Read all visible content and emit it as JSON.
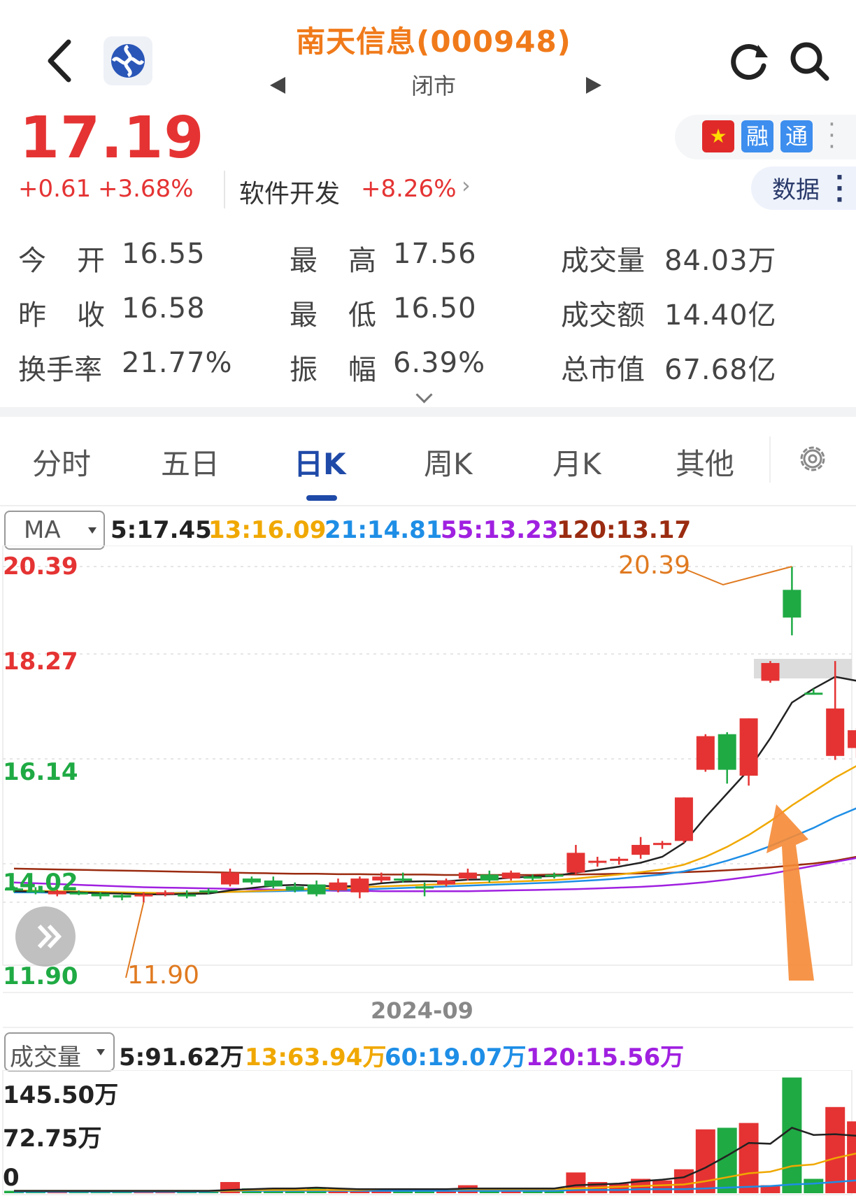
{
  "header": {
    "title": "南天信息(000948)",
    "status": "闭市",
    "back_icon": "chevron-left-icon",
    "refresh_icon": "refresh-icon",
    "search_icon": "search-icon"
  },
  "quote": {
    "price": "17.19",
    "change": "+0.61",
    "change_pct": "+3.68%",
    "industry": "软件开发",
    "industry_pct": "+8.26%",
    "up_color": "#e53333",
    "down_color": "#1faa44"
  },
  "badges": {
    "cn": "★",
    "rong": "融",
    "tong": "通",
    "data_label": "数据"
  },
  "stats": {
    "open_label_a": "今",
    "open_label_b": "开",
    "open": "16.55",
    "high_label_a": "最",
    "high_label_b": "高",
    "high": "17.56",
    "volume_label": "成交量",
    "volume": "84.03万",
    "prev_label_a": "昨",
    "prev_label_b": "收",
    "prev": "16.58",
    "low_label_a": "最",
    "low_label_b": "低",
    "low": "16.50",
    "amount_label": "成交额",
    "amount": "14.40亿",
    "turnover_label": "换手率",
    "turnover": "21.77%",
    "amp_label_a": "振",
    "amp_label_b": "幅",
    "amplitude": "6.39%",
    "mcap_label": "总市值",
    "mcap": "67.68亿"
  },
  "tabs": [
    {
      "label": "分时"
    },
    {
      "label": "五日"
    },
    {
      "label": "日K"
    },
    {
      "label": "周K"
    },
    {
      "label": "月K"
    },
    {
      "label": "其他"
    }
  ],
  "ma_row": {
    "selector": "MA",
    "ma5": "5:17.45",
    "ma13": "13:16.09",
    "ma21": "21:14.81",
    "ma55": "55:13.23",
    "ma120": "120:13.17",
    "colors": {
      "ma5": "#222222",
      "ma13": "#f0a800",
      "ma21": "#1e8ee6",
      "ma55": "#a020e0",
      "ma120": "#9a2b10"
    }
  },
  "vol_row": {
    "selector": "成交量",
    "v5": "5:91.62万",
    "v13": "13:63.94万",
    "v60": "60:19.07万",
    "v120": "120:15.56万"
  },
  "y_labels": {
    "top": "20.39",
    "mid1": "18.27",
    "mid2": "16.14",
    "mid3": "14.02",
    "bottom": "11.90"
  },
  "vol_labels": {
    "top": "145.50万",
    "mid": "72.75万",
    "zero": "0"
  },
  "x_label": "2024-09",
  "chart_data": {
    "type": "candlestick",
    "ylim": [
      11.9,
      20.39
    ],
    "max_label": "20.39",
    "min_label": "11.90",
    "candles": [
      {
        "o": 12.25,
        "c": 12.2,
        "h": 12.3,
        "l": 12.15
      },
      {
        "o": 12.2,
        "c": 12.15,
        "h": 12.28,
        "l": 12.1
      },
      {
        "o": 12.1,
        "c": 12.18,
        "h": 12.22,
        "l": 12.05
      },
      {
        "o": 12.15,
        "c": 12.12,
        "h": 12.2,
        "l": 12.08
      },
      {
        "o": 12.12,
        "c": 12.05,
        "h": 12.15,
        "l": 11.98
      },
      {
        "o": 12.08,
        "c": 12.02,
        "h": 12.12,
        "l": 11.95
      },
      {
        "o": 12.05,
        "c": 12.1,
        "h": 12.15,
        "l": 11.9
      },
      {
        "o": 12.1,
        "c": 12.15,
        "h": 12.2,
        "l": 12.05
      },
      {
        "o": 12.1,
        "c": 12.05,
        "h": 12.2,
        "l": 12.0
      },
      {
        "o": 12.2,
        "c": 12.15,
        "h": 12.25,
        "l": 12.1
      },
      {
        "o": 12.35,
        "c": 12.65,
        "h": 12.75,
        "l": 12.3
      },
      {
        "o": 12.5,
        "c": 12.4,
        "h": 12.55,
        "l": 12.35
      },
      {
        "o": 12.45,
        "c": 12.3,
        "h": 12.55,
        "l": 12.25
      },
      {
        "o": 12.3,
        "c": 12.2,
        "h": 12.4,
        "l": 12.15
      },
      {
        "o": 12.35,
        "c": 12.1,
        "h": 12.45,
        "l": 12.05
      },
      {
        "o": 12.2,
        "c": 12.4,
        "h": 12.5,
        "l": 12.15
      },
      {
        "o": 12.15,
        "c": 12.5,
        "h": 12.55,
        "l": 12.0
      },
      {
        "o": 12.45,
        "c": 12.55,
        "h": 12.65,
        "l": 12.4
      },
      {
        "o": 12.5,
        "c": 12.45,
        "h": 12.65,
        "l": 12.4
      },
      {
        "o": 12.3,
        "c": 12.25,
        "h": 12.4,
        "l": 12.05
      },
      {
        "o": 12.35,
        "c": 12.45,
        "h": 12.5,
        "l": 12.3
      },
      {
        "o": 12.5,
        "c": 12.65,
        "h": 12.75,
        "l": 12.45
      },
      {
        "o": 12.6,
        "c": 12.45,
        "h": 12.7,
        "l": 12.4
      },
      {
        "o": 12.5,
        "c": 12.65,
        "h": 12.7,
        "l": 12.45
      },
      {
        "o": 12.55,
        "c": 12.5,
        "h": 12.6,
        "l": 12.45
      },
      {
        "o": 12.6,
        "c": 12.55,
        "h": 12.65,
        "l": 12.5
      },
      {
        "o": 12.65,
        "c": 13.15,
        "h": 13.35,
        "l": 12.6
      },
      {
        "o": 12.9,
        "c": 12.95,
        "h": 13.05,
        "l": 12.8
      },
      {
        "o": 12.95,
        "c": 13.0,
        "h": 13.05,
        "l": 12.85
      },
      {
        "o": 13.1,
        "c": 13.35,
        "h": 13.55,
        "l": 13.0
      },
      {
        "o": 13.35,
        "c": 13.4,
        "h": 13.45,
        "l": 13.25
      },
      {
        "o": 13.45,
        "c": 14.55,
        "h": 14.55,
        "l": 13.4
      },
      {
        "o": 15.25,
        "c": 16.1,
        "h": 16.15,
        "l": 15.2
      },
      {
        "o": 16.15,
        "c": 15.25,
        "h": 16.2,
        "l": 14.9
      },
      {
        "o": 15.1,
        "c": 16.55,
        "h": 16.55,
        "l": 14.85
      },
      {
        "o": 17.5,
        "c": 17.95,
        "h": 18.0,
        "l": 17.45
      },
      {
        "o": 19.8,
        "c": 19.1,
        "h": 20.39,
        "l": 18.65
      },
      {
        "o": 17.2,
        "c": 17.15,
        "h": 17.3,
        "l": 17.15
      },
      {
        "o": 15.6,
        "c": 16.8,
        "h": 18.0,
        "l": 15.5
      },
      {
        "o": 15.8,
        "c": 16.25,
        "h": 16.3,
        "l": 15.55
      },
      {
        "o": 16.35,
        "c": 16.85,
        "h": 17.2,
        "l": 16.3
      }
    ],
    "ma5": [
      12.18,
      12.17,
      12.16,
      12.15,
      12.13,
      12.12,
      12.1,
      12.1,
      12.11,
      12.12,
      12.2,
      12.26,
      12.32,
      12.34,
      12.32,
      12.3,
      12.31,
      12.38,
      12.42,
      12.43,
      12.43,
      12.47,
      12.48,
      12.52,
      12.55,
      12.56,
      12.65,
      12.72,
      12.8,
      12.9,
      13.05,
      13.4,
      14.05,
      14.65,
      15.25,
      16.05,
      16.95,
      17.3,
      17.6,
      17.5,
      17.2
    ],
    "ma13": [
      12.2,
      12.19,
      12.18,
      12.17,
      12.16,
      12.15,
      12.14,
      12.13,
      12.13,
      12.14,
      12.16,
      12.18,
      12.2,
      12.22,
      12.24,
      12.26,
      12.28,
      12.3,
      12.32,
      12.34,
      12.36,
      12.38,
      12.4,
      12.42,
      12.44,
      12.46,
      12.5,
      12.55,
      12.6,
      12.66,
      12.73,
      12.85,
      13.05,
      13.3,
      13.6,
      13.95,
      14.35,
      14.7,
      15.05,
      15.35,
      15.65
    ],
    "ma21": [
      12.15,
      12.15,
      12.14,
      12.14,
      12.13,
      12.13,
      12.13,
      12.13,
      12.14,
      12.15,
      12.16,
      12.17,
      12.18,
      12.19,
      12.2,
      12.21,
      12.22,
      12.24,
      12.26,
      12.28,
      12.3,
      12.32,
      12.34,
      12.36,
      12.38,
      12.4,
      12.43,
      12.46,
      12.5,
      12.55,
      12.6,
      12.68,
      12.8,
      12.95,
      13.12,
      13.32,
      13.55,
      13.78,
      14.05,
      14.28,
      14.5
    ],
    "ma55": [
      12.4,
      12.38,
      12.36,
      12.34,
      12.32,
      12.3,
      12.28,
      12.27,
      12.26,
      12.25,
      12.24,
      12.23,
      12.22,
      12.21,
      12.2,
      12.19,
      12.19,
      12.18,
      12.18,
      12.18,
      12.18,
      12.18,
      12.19,
      12.2,
      12.21,
      12.22,
      12.23,
      12.25,
      12.27,
      12.29,
      12.32,
      12.36,
      12.41,
      12.47,
      12.54,
      12.62,
      12.72,
      12.82,
      12.92,
      13.02,
      13.12
    ],
    "ma120": [
      12.75,
      12.74,
      12.73,
      12.72,
      12.71,
      12.7,
      12.69,
      12.68,
      12.67,
      12.66,
      12.65,
      12.64,
      12.63,
      12.62,
      12.62,
      12.61,
      12.61,
      12.6,
      12.6,
      12.6,
      12.59,
      12.59,
      12.59,
      12.59,
      12.59,
      12.6,
      12.6,
      12.61,
      12.62,
      12.63,
      12.64,
      12.66,
      12.68,
      12.71,
      12.74,
      12.78,
      12.83,
      12.88,
      12.95,
      13.05,
      13.17
    ],
    "volume_ylim": [
      0,
      145.5
    ],
    "volumes": [
      3,
      2,
      3,
      2,
      2,
      3,
      2,
      3,
      2,
      2,
      14,
      6,
      5,
      4,
      6,
      5,
      4,
      6,
      5,
      4,
      5,
      10,
      6,
      5,
      4,
      4,
      26,
      14,
      12,
      18,
      16,
      30,
      80,
      82,
      88,
      10,
      145,
      18,
      108,
      90,
      86
    ],
    "volume_ma5": [
      3,
      3,
      3,
      3,
      3,
      3,
      3,
      3,
      3,
      3,
      4,
      5,
      6,
      6,
      7,
      6,
      5,
      5,
      5,
      5,
      5,
      6,
      6,
      6,
      6,
      6,
      10,
      11,
      12,
      15,
      17,
      20,
      32,
      47,
      63,
      62,
      82,
      73,
      74,
      72,
      91.62
    ],
    "volume_ma13": [
      3,
      3,
      3,
      3,
      3,
      3,
      3,
      3,
      3,
      3,
      3,
      4,
      4,
      4,
      4,
      4,
      4,
      5,
      5,
      5,
      5,
      5,
      5,
      5,
      5,
      5,
      6,
      7,
      8,
      9,
      10,
      11,
      15,
      20,
      25,
      27,
      34,
      36,
      44,
      50,
      63.94
    ],
    "volume_ma60": [
      2,
      2,
      2,
      2,
      2,
      2,
      2,
      2,
      2,
      2,
      3,
      3,
      3,
      3,
      3,
      3,
      3,
      3,
      3,
      3,
      3,
      3,
      3,
      3,
      3,
      3,
      4,
      4,
      4,
      5,
      5,
      5,
      6,
      7,
      8,
      9,
      11,
      12,
      14,
      16,
      19.07
    ]
  }
}
